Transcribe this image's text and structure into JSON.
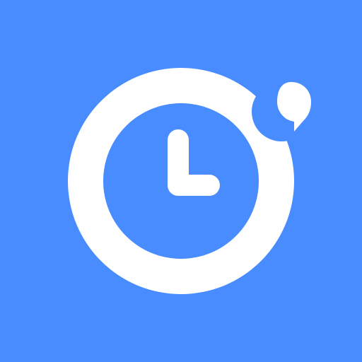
{
  "icon": {
    "name": "clock-chat-app-icon",
    "colors": {
      "background": "#488cff",
      "foreground": "#ffffff"
    }
  }
}
